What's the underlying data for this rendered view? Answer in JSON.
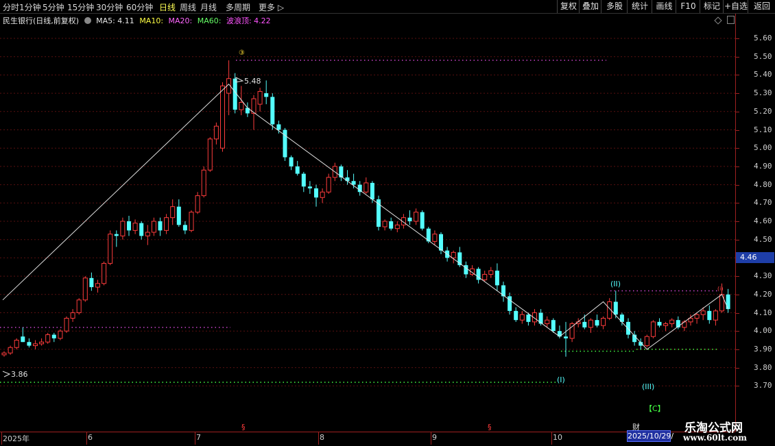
{
  "toolbar": {
    "periods": [
      "分时",
      "1分钟",
      "5分钟",
      "15分钟",
      "30分钟",
      "60分钟",
      "日线",
      "周线",
      "月线",
      "多周期",
      "更多"
    ],
    "active_period": "日线",
    "right_buttons": [
      "复权",
      "叠加",
      "多股",
      "统计",
      "画线",
      "F10",
      "标记",
      "+自选",
      "返回"
    ]
  },
  "info": {
    "title": "民生银行(日线,前复权)",
    "ma5": "MA5: 4.11",
    "ma10": "MA10:",
    "ma20": "MA20:",
    "ma60": "MA60:",
    "wave_top": "波浪顶: 4.22"
  },
  "colors": {
    "up": "#ff3c3c",
    "down": "#54ffff",
    "wave_line": "#e0e0e0",
    "dotted_magenta": "#cc44cc",
    "dotted_green": "#44ff44",
    "grid": "#5a1010"
  },
  "price_axis": {
    "ticks": [
      "5.60",
      "5.50",
      "5.40",
      "5.30",
      "5.20",
      "5.10",
      "5.00",
      "4.90",
      "4.80",
      "4.70",
      "4.60",
      "4.50",
      "4.40",
      "4.30",
      "4.20",
      "4.10",
      "4.00",
      "3.90",
      "3.80",
      "3.70"
    ],
    "current_price": "4.46"
  },
  "time_axis": {
    "labels": [
      "2025年",
      "6",
      "7",
      "8",
      "9",
      "10"
    ],
    "markers": [
      "§",
      "§",
      "财"
    ],
    "cursor_date": "2025/10/29/"
  },
  "annotations": {
    "high": "5.48",
    "low": "3.86",
    "wave_3": "③",
    "wave_I": "(I)",
    "wave_II": "(II)",
    "wave_III": "(III)",
    "wave_C": "【C】",
    "wave_i": "(i)"
  },
  "chart_data": {
    "type": "candlestick",
    "title": "民生银行(日线,前复权)",
    "y_range": [
      3.7,
      5.6
    ],
    "period_high": 5.48,
    "period_low": 3.86,
    "last_close": 4.11,
    "current_marker": 4.46,
    "candles": [
      [
        3.87,
        3.89,
        3.86,
        3.88
      ],
      [
        3.88,
        3.92,
        3.87,
        3.91
      ],
      [
        3.91,
        3.96,
        3.9,
        3.95
      ],
      [
        3.97,
        4.02,
        3.94,
        3.94
      ],
      [
        3.94,
        3.96,
        3.91,
        3.92
      ],
      [
        3.92,
        3.95,
        3.9,
        3.93
      ],
      [
        3.93,
        3.96,
        3.92,
        3.94
      ],
      [
        3.94,
        3.99,
        3.93,
        3.98
      ],
      [
        3.98,
        3.99,
        3.94,
        3.96
      ],
      [
        3.96,
        4.01,
        3.95,
        4.0
      ],
      [
        4.0,
        4.08,
        3.99,
        4.07
      ],
      [
        4.07,
        4.12,
        4.05,
        4.1
      ],
      [
        4.1,
        4.18,
        4.09,
        4.17
      ],
      [
        4.17,
        4.3,
        4.16,
        4.29
      ],
      [
        4.29,
        4.32,
        4.22,
        4.24
      ],
      [
        4.24,
        4.28,
        4.21,
        4.26
      ],
      [
        4.26,
        4.38,
        4.25,
        4.37
      ],
      [
        4.37,
        4.55,
        4.36,
        4.53
      ],
      [
        4.53,
        4.55,
        4.46,
        4.52
      ],
      [
        4.52,
        4.62,
        4.5,
        4.6
      ],
      [
        4.6,
        4.63,
        4.52,
        4.55
      ],
      [
        4.55,
        4.61,
        4.53,
        4.59
      ],
      [
        4.59,
        4.6,
        4.5,
        4.52
      ],
      [
        4.52,
        4.58,
        4.47,
        4.54
      ],
      [
        4.54,
        4.62,
        4.52,
        4.6
      ],
      [
        4.6,
        4.62,
        4.52,
        4.55
      ],
      [
        4.55,
        4.64,
        4.53,
        4.62
      ],
      [
        4.62,
        4.72,
        4.58,
        4.68
      ],
      [
        4.68,
        4.72,
        4.57,
        4.58
      ],
      [
        4.58,
        4.6,
        4.53,
        4.55
      ],
      [
        4.55,
        4.66,
        4.54,
        4.65
      ],
      [
        4.65,
        4.76,
        4.64,
        4.74
      ],
      [
        4.74,
        4.9,
        4.73,
        4.88
      ],
      [
        4.88,
        5.06,
        4.87,
        5.05
      ],
      [
        5.05,
        5.14,
        5.02,
        5.12
      ],
      [
        5.0,
        5.36,
        4.98,
        5.34
      ],
      [
        5.3,
        5.48,
        5.18,
        5.38
      ],
      [
        5.38,
        5.41,
        5.19,
        5.21
      ],
      [
        5.21,
        5.34,
        5.18,
        5.25
      ],
      [
        5.22,
        5.25,
        5.17,
        5.19
      ],
      [
        5.19,
        5.29,
        5.1,
        5.27
      ],
      [
        5.24,
        5.33,
        5.2,
        5.31
      ],
      [
        5.3,
        5.37,
        5.24,
        5.28
      ],
      [
        5.28,
        5.3,
        5.1,
        5.13
      ],
      [
        5.13,
        5.15,
        5.08,
        5.1
      ],
      [
        5.1,
        5.11,
        4.93,
        4.95
      ],
      [
        4.95,
        4.96,
        4.88,
        4.9
      ],
      [
        4.9,
        4.93,
        4.85,
        4.86
      ],
      [
        4.86,
        4.87,
        4.76,
        4.79
      ],
      [
        4.79,
        4.82,
        4.75,
        4.78
      ],
      [
        4.78,
        4.8,
        4.68,
        4.73
      ],
      [
        4.73,
        4.78,
        4.7,
        4.76
      ],
      [
        4.76,
        4.86,
        4.75,
        4.84
      ],
      [
        4.84,
        4.92,
        4.82,
        4.9
      ],
      [
        4.9,
        4.91,
        4.82,
        4.84
      ],
      [
        4.84,
        4.88,
        4.8,
        4.82
      ],
      [
        4.82,
        4.86,
        4.78,
        4.8
      ],
      [
        4.8,
        4.82,
        4.74,
        4.76
      ],
      [
        4.76,
        4.84,
        4.75,
        4.81
      ],
      [
        4.81,
        4.82,
        4.7,
        4.72
      ],
      [
        4.72,
        4.74,
        4.55,
        4.57
      ],
      [
        4.57,
        4.61,
        4.55,
        4.6
      ],
      [
        4.6,
        4.62,
        4.55,
        4.56
      ],
      [
        4.56,
        4.6,
        4.54,
        4.58
      ],
      [
        4.58,
        4.64,
        4.56,
        4.62
      ],
      [
        4.62,
        4.66,
        4.58,
        4.6
      ],
      [
        4.6,
        4.67,
        4.58,
        4.65
      ],
      [
        4.65,
        4.66,
        4.55,
        4.56
      ],
      [
        4.56,
        4.57,
        4.48,
        4.49
      ],
      [
        4.49,
        4.55,
        4.47,
        4.53
      ],
      [
        4.53,
        4.54,
        4.42,
        4.44
      ],
      [
        4.44,
        4.46,
        4.38,
        4.4
      ],
      [
        4.4,
        4.44,
        4.37,
        4.43
      ],
      [
        4.43,
        4.46,
        4.35,
        4.36
      ],
      [
        4.36,
        4.38,
        4.29,
        4.31
      ],
      [
        4.31,
        4.36,
        4.3,
        4.34
      ],
      [
        4.34,
        4.35,
        4.26,
        4.28
      ],
      [
        4.28,
        4.33,
        4.27,
        4.31
      ],
      [
        4.31,
        4.35,
        4.29,
        4.33
      ],
      [
        4.33,
        4.37,
        4.22,
        4.25
      ],
      [
        4.25,
        4.27,
        4.16,
        4.19
      ],
      [
        4.19,
        4.21,
        4.09,
        4.11
      ],
      [
        4.11,
        4.13,
        4.05,
        4.06
      ],
      [
        4.06,
        4.11,
        4.04,
        4.09
      ],
      [
        4.09,
        4.1,
        4.03,
        4.05
      ],
      [
        4.05,
        4.12,
        4.03,
        4.1
      ],
      [
        4.1,
        4.12,
        4.03,
        4.04
      ],
      [
        4.04,
        4.08,
        4.02,
        4.06
      ],
      [
        4.06,
        4.07,
        3.99,
        4.0
      ],
      [
        4.0,
        4.03,
        3.96,
        3.97
      ],
      [
        3.97,
        4.05,
        3.86,
        3.96
      ],
      [
        3.96,
        4.05,
        3.94,
        4.04
      ],
      [
        4.04,
        4.07,
        4.02,
        4.05
      ],
      [
        4.05,
        4.09,
        4.01,
        4.02
      ],
      [
        4.02,
        4.07,
        3.99,
        4.06
      ],
      [
        4.06,
        4.09,
        4.02,
        4.03
      ],
      [
        4.03,
        4.08,
        4.01,
        4.07
      ],
      [
        4.07,
        4.18,
        4.06,
        4.16
      ],
      [
        4.16,
        4.22,
        4.07,
        4.09
      ],
      [
        4.09,
        4.1,
        4.03,
        4.05
      ],
      [
        4.05,
        4.07,
        3.96,
        3.98
      ],
      [
        3.98,
        4.0,
        3.92,
        3.94
      ],
      [
        3.94,
        3.96,
        3.9,
        3.92
      ],
      [
        3.92,
        3.98,
        3.91,
        3.97
      ],
      [
        3.97,
        4.06,
        3.96,
        4.05
      ],
      [
        4.05,
        4.07,
        4.02,
        4.03
      ],
      [
        4.03,
        4.05,
        4.0,
        4.04
      ],
      [
        4.04,
        4.07,
        4.02,
        4.06
      ],
      [
        4.06,
        4.08,
        4.01,
        4.02
      ],
      [
        4.02,
        4.06,
        4.0,
        4.05
      ],
      [
        4.05,
        4.09,
        4.03,
        4.07
      ],
      [
        4.07,
        4.1,
        4.04,
        4.09
      ],
      [
        4.09,
        4.13,
        4.06,
        4.11
      ],
      [
        4.11,
        4.14,
        4.04,
        4.06
      ],
      [
        4.06,
        4.12,
        4.03,
        4.11
      ],
      [
        4.11,
        4.26,
        4.1,
        4.2
      ],
      [
        4.2,
        4.23,
        4.1,
        4.12
      ]
    ],
    "wave_points": [
      [
        4.17,
        0
      ],
      [
        5.35,
        36
      ],
      [
        5.22,
        39
      ],
      [
        3.97,
        89
      ],
      [
        4.16,
        96
      ],
      [
        3.9,
        103
      ],
      [
        4.2,
        115
      ],
      [
        4.12,
        116
      ]
    ]
  }
}
